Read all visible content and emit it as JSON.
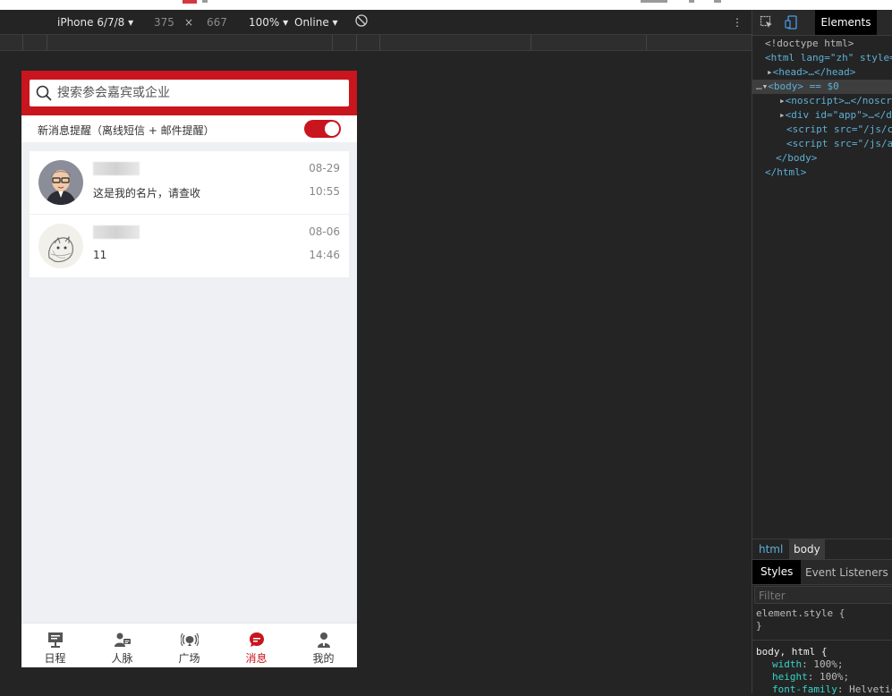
{
  "device_toolbar": {
    "device": "iPhone 6/7/8 ▾",
    "width": "375",
    "times": "×",
    "height": "667",
    "zoom": "100% ▾",
    "network": "Online ▾",
    "more": "⋮"
  },
  "phone": {
    "search": {
      "placeholder": "搜索参会嘉宾或企业"
    },
    "notification": {
      "label": "新消息提醒（离线短信 + 邮件提醒）",
      "enabled": true
    },
    "messages": [
      {
        "name": "",
        "text": "这是我的名片，请查收",
        "date": "08-29",
        "time": "10:55",
        "avatar": "cartoon-man-glasses"
      },
      {
        "name": "",
        "text": "11",
        "date": "08-06",
        "time": "14:46",
        "avatar": "ink-drawing-cat"
      }
    ],
    "tabs": [
      {
        "label": "日程",
        "icon": "presentation-icon",
        "active": false
      },
      {
        "label": "人脉",
        "icon": "contacts-icon",
        "active": false
      },
      {
        "label": "广场",
        "icon": "broadcast-icon",
        "active": false
      },
      {
        "label": "消息",
        "icon": "chat-icon",
        "active": true
      },
      {
        "label": "我的",
        "icon": "person-icon",
        "active": false
      }
    ],
    "accent_color": "#c9151e"
  },
  "devtools": {
    "active_tab": "Elements",
    "dom_lines": [
      "<!doctype html>",
      "<html lang=\"zh\" style=",
      "<head>…</head>",
      "<body> == $0",
      "<noscript>…</noscr",
      "<div id=\"app\">…</d",
      "<script src=\"/js/c",
      "<script src=\"/js/a",
      "</body>",
      "</html>"
    ],
    "breadcrumbs": [
      "html",
      "body"
    ],
    "subtabs": [
      "Styles",
      "Event Listeners"
    ],
    "filter_placeholder": "Filter",
    "styles": {
      "element_style": "element.style {",
      "element_close": "}",
      "rule_selector": "body, html {",
      "props": [
        {
          "name": "width",
          "value": "100%;"
        },
        {
          "name": "height",
          "value": "100%;"
        },
        {
          "name": "font-family",
          "value": "Helvetic"
        }
      ]
    }
  }
}
